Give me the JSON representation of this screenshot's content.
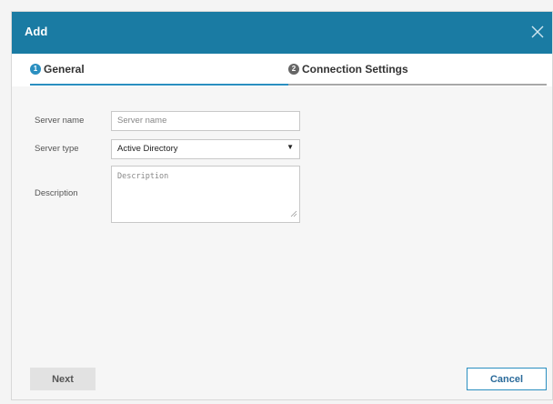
{
  "dialog": {
    "title": "Add",
    "close_icon": "close-icon"
  },
  "tabs": [
    {
      "number": "1",
      "label": "General",
      "active": true
    },
    {
      "number": "2",
      "label": "Connection Settings",
      "active": false
    }
  ],
  "form": {
    "server_name": {
      "label": "Server name",
      "value": "",
      "placeholder": "Server name"
    },
    "server_type": {
      "label": "Server type",
      "selected": "Active Directory"
    },
    "description": {
      "label": "Description",
      "value": "",
      "placeholder": "Description"
    }
  },
  "buttons": {
    "next": "Next",
    "cancel": "Cancel"
  },
  "colors": {
    "titlebar": "#1a7ba3",
    "accent": "#2a8fc0"
  }
}
